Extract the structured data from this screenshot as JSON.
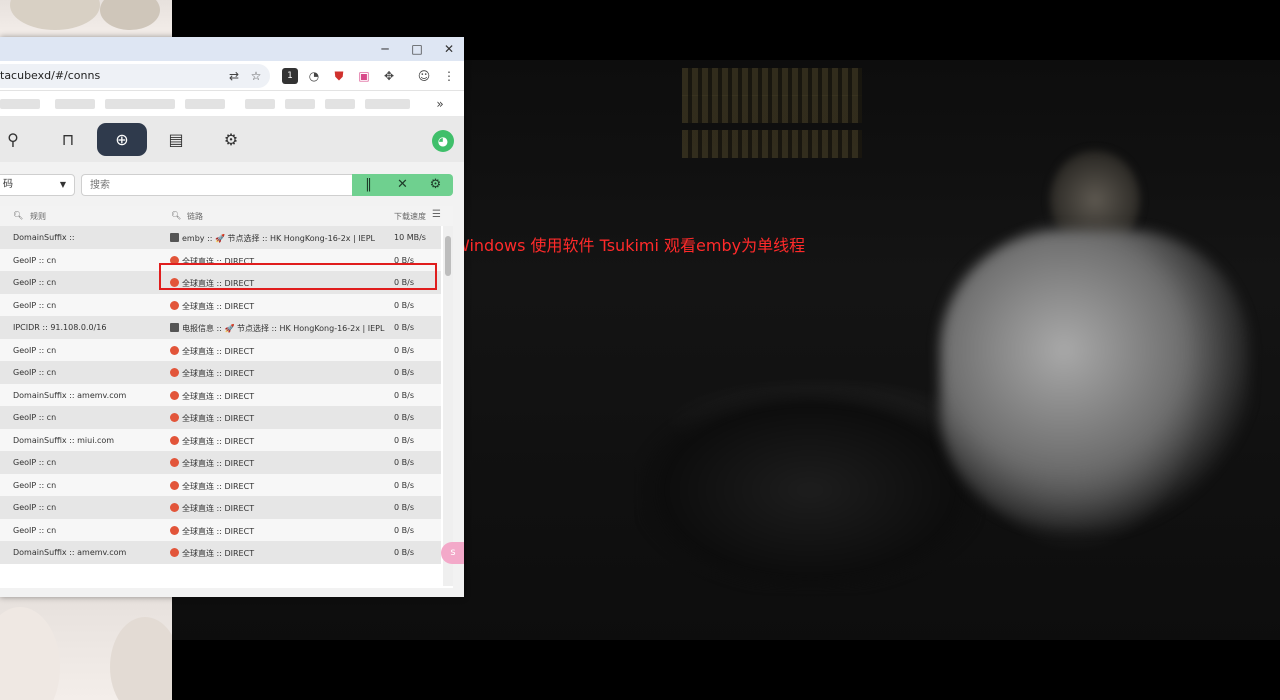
{
  "browser": {
    "address": "tacubexd/#/conns",
    "window_buttons": {
      "minimize": "─",
      "maximize": "□",
      "close": "✕"
    },
    "toolbar_icons": [
      "translate-icon",
      "star-icon",
      "extension-badge-icon",
      "extension-gauge-icon",
      "extension-shield-icon",
      "extension-pink-icon",
      "puzzle-icon",
      "avatar-icon",
      "menu-icon"
    ],
    "extension_badge": "1",
    "bookmarks_overflow": "»"
  },
  "app": {
    "nav": [
      "overview-icon",
      "proxies-icon",
      "connections-icon",
      "logs-icon",
      "settings-icon"
    ],
    "active_nav": 2,
    "group_select": {
      "value": "码"
    },
    "search": {
      "placeholder": "搜索"
    },
    "controls": {
      "pause": "‖",
      "close_all": "✕",
      "settings": "⚙"
    },
    "table": {
      "headers": {
        "rule": "规则",
        "chain": "链路",
        "speed": "下载速度"
      },
      "rows": [
        {
          "rule": "DomainSuffix :: ",
          "chain": "emby :: 🚀 节点选择 :: HK HongKong-16-2x | IEPL",
          "speed": "10 MB/s",
          "icon": "box"
        },
        {
          "rule": "GeoIP :: cn",
          "chain": "全球直连 :: DIRECT",
          "speed": "0 B/s",
          "icon": "dot"
        },
        {
          "rule": "GeoIP :: cn",
          "chain": "全球直连 :: DIRECT",
          "speed": "0 B/s",
          "icon": "dot"
        },
        {
          "rule": "GeoIP :: cn",
          "chain": "全球直连 :: DIRECT",
          "speed": "0 B/s",
          "icon": "dot"
        },
        {
          "rule": "IPCIDR :: 91.108.0.0/16",
          "chain": "电报信息 :: 🚀 节点选择 :: HK HongKong-16-2x | IEPL",
          "speed": "0 B/s",
          "icon": "box"
        },
        {
          "rule": "GeoIP :: cn",
          "chain": "全球直连 :: DIRECT",
          "speed": "0 B/s",
          "icon": "dot"
        },
        {
          "rule": "GeoIP :: cn",
          "chain": "全球直连 :: DIRECT",
          "speed": "0 B/s",
          "icon": "dot"
        },
        {
          "rule": "DomainSuffix :: amemv.com",
          "chain": "全球直连 :: DIRECT",
          "speed": "0 B/s",
          "icon": "dot"
        },
        {
          "rule": "GeoIP :: cn",
          "chain": "全球直连 :: DIRECT",
          "speed": "0 B/s",
          "icon": "dot"
        },
        {
          "rule": "DomainSuffix :: miui.com",
          "chain": "全球直连 :: DIRECT",
          "speed": "0 B/s",
          "icon": "dot"
        },
        {
          "rule": "GeoIP :: cn",
          "chain": "全球直连 :: DIRECT",
          "speed": "0 B/s",
          "icon": "dot"
        },
        {
          "rule": "GeoIP :: cn",
          "chain": "全球直连 :: DIRECT",
          "speed": "0 B/s",
          "icon": "dot"
        },
        {
          "rule": "GeoIP :: cn",
          "chain": "全球直连 :: DIRECT",
          "speed": "0 B/s",
          "icon": "dot"
        },
        {
          "rule": "GeoIP :: cn",
          "chain": "全球直连 :: DIRECT",
          "speed": "0 B/s",
          "icon": "dot"
        },
        {
          "rule": "DomainSuffix :: amemv.com",
          "chain": "全球直连 :: DIRECT",
          "speed": "0 B/s",
          "icon": "dot"
        }
      ]
    },
    "float_widget": "ꜱ"
  },
  "annotation": "Windows 使用软件 Tsukimi 观看emby为单线程",
  "colors": {
    "annotation": "#ff2a2a",
    "highlight": "#e01d1d",
    "accent_green": "#6fd08f",
    "active_nav": "#2f3a4c"
  }
}
